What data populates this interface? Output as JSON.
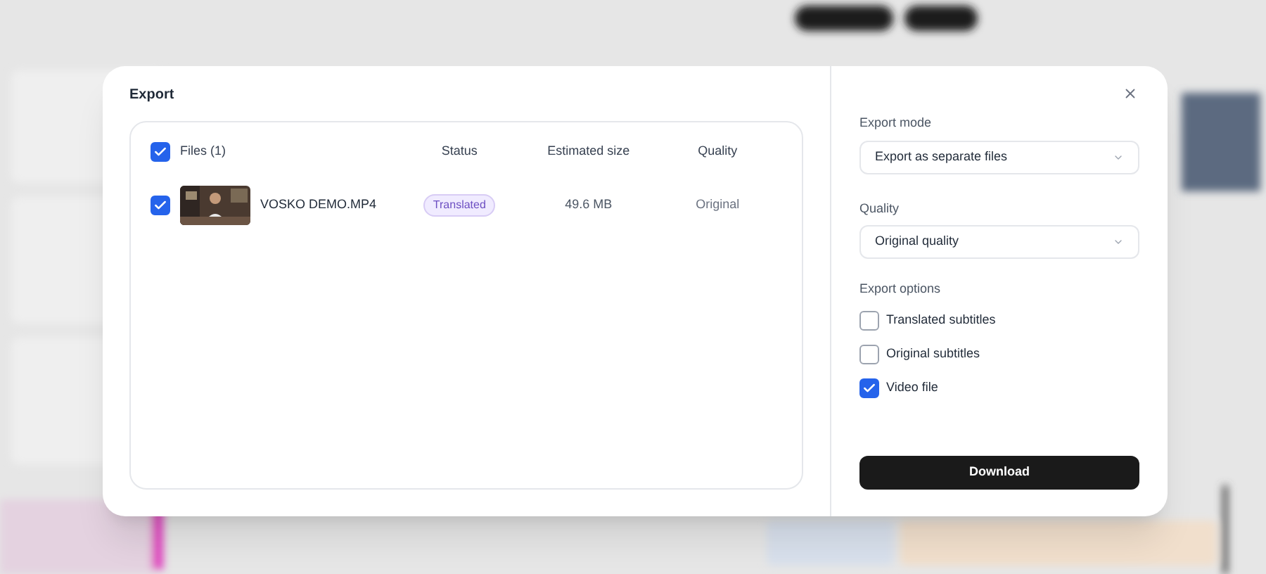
{
  "dialog": {
    "title": "Export",
    "files_table": {
      "select_all": {
        "label": "Files (1)",
        "checked": true
      },
      "columns": [
        "Status",
        "Estimated size",
        "Quality"
      ],
      "rows": [
        {
          "checked": true,
          "name": "VOSKO DEMO.MP4",
          "status": "Translated",
          "size": "49.6 MB",
          "quality": "Original"
        }
      ]
    },
    "settings": {
      "export_mode": {
        "label": "Export mode",
        "value": "Export as separate files"
      },
      "quality": {
        "label": "Quality",
        "value": "Original quality"
      },
      "options_label": "Export options",
      "options": [
        {
          "label": "Translated subtitles",
          "checked": false
        },
        {
          "label": "Original subtitles",
          "checked": false
        },
        {
          "label": "Video file",
          "checked": true
        }
      ],
      "download_button": "Download"
    }
  }
}
